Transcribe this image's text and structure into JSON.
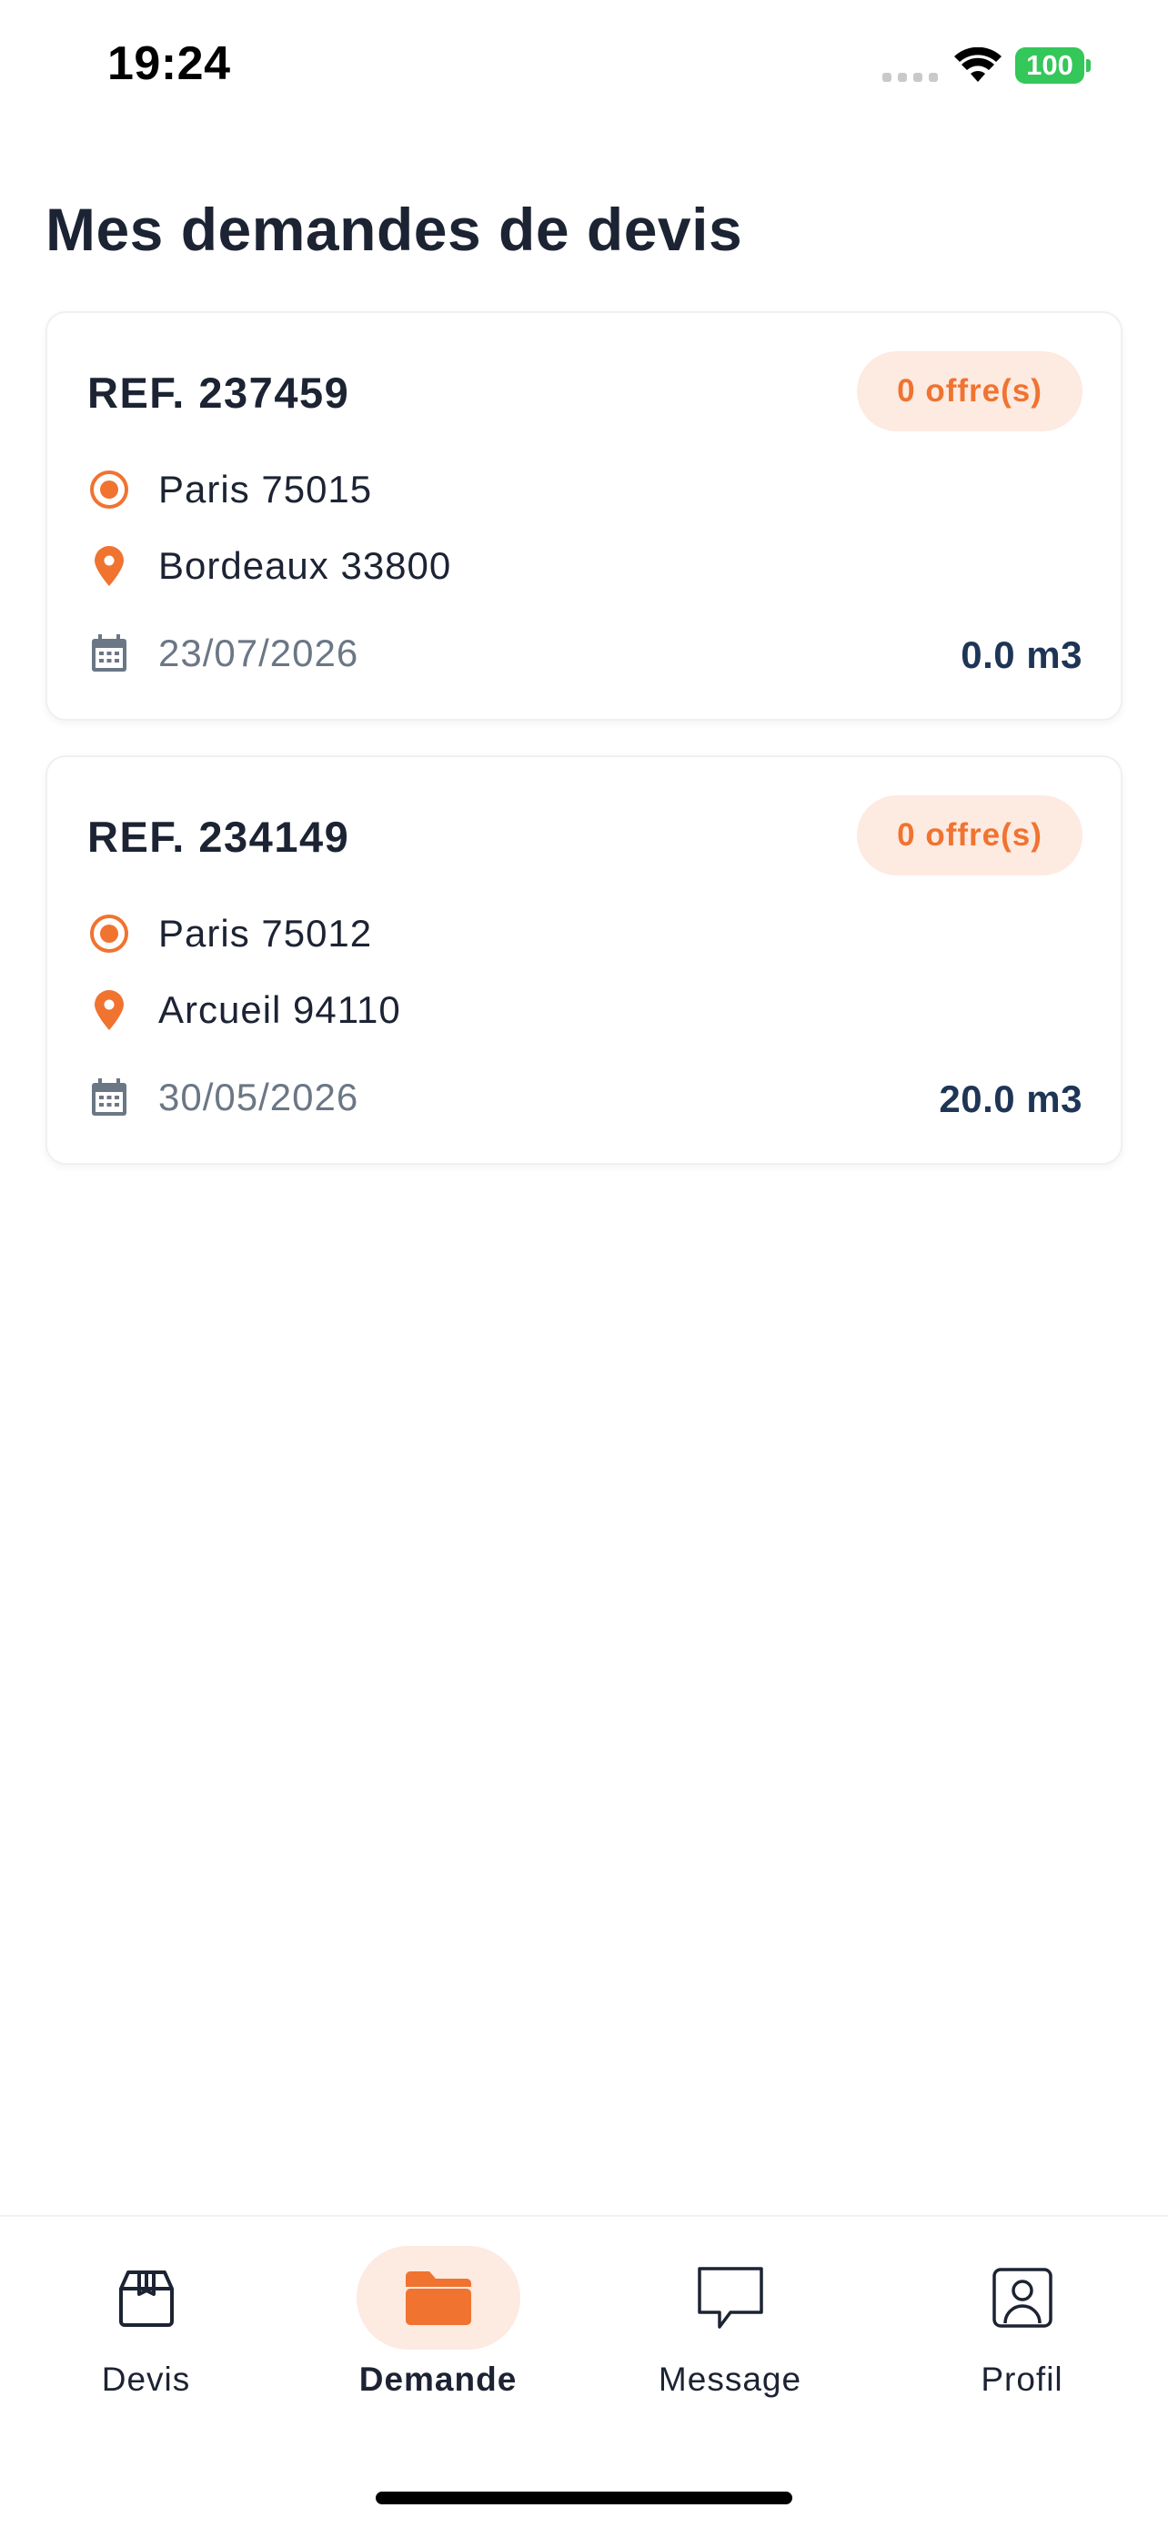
{
  "status_bar": {
    "time": "19:24",
    "battery": "100",
    "icons": [
      "signal-icon",
      "wifi-icon",
      "battery-icon"
    ]
  },
  "page": {
    "title": "Mes demandes de devis"
  },
  "colors": {
    "accent": "#f07330",
    "accent_light": "#fdeae0",
    "text_dark": "#1c2333",
    "text_muted": "#6b7785",
    "volume_blue": "#1e3556",
    "battery_green": "#34c759"
  },
  "requests": [
    {
      "ref": "REF. 237459",
      "offers": "0 offre(s)",
      "origin": "Paris 75015",
      "destination": "Bordeaux 33800",
      "date": "23/07/2026",
      "volume": "0.0 m3"
    },
    {
      "ref": "REF. 234149",
      "offers": "0 offre(s)",
      "origin": "Paris 75012",
      "destination": "Arcueil 94110",
      "date": "30/05/2026",
      "volume": "20.0 m3"
    }
  ],
  "tabs": [
    {
      "label": "Devis",
      "icon": "box-icon",
      "active": false
    },
    {
      "label": "Demande",
      "icon": "folder-icon",
      "active": true
    },
    {
      "label": "Message",
      "icon": "chat-icon",
      "active": false
    },
    {
      "label": "Profil",
      "icon": "profile-icon",
      "active": false
    }
  ]
}
